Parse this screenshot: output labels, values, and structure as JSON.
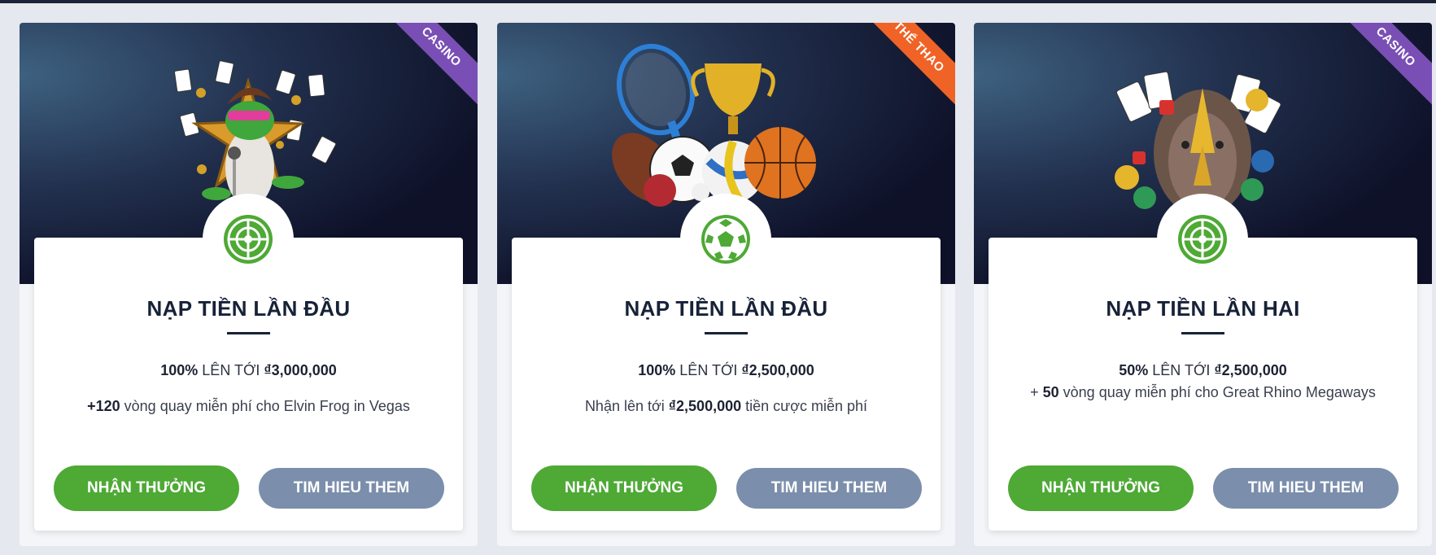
{
  "colors": {
    "accent_green": "#4ea935",
    "secondary_button": "#7b8eab",
    "casino_ribbon": "#7a4fb5",
    "sports_ribbon": "#ef6326",
    "title": "#172238"
  },
  "cards": [
    {
      "ribbon": "CASINO",
      "art": "frog-singer-casino-art",
      "icon": "roulette-icon",
      "title": "NẠP TIỀN LẦN ĐẦU",
      "line1_bold": "100%",
      "line1_mid": " LÊN TỚI ",
      "line1_amount": "₫3,000,000",
      "line2_bold": "+120",
      "line2_text": " vòng quay miễn phí cho Elvin Frog in Vegas",
      "claim_label": "NHẬN THƯỞNG",
      "more_label": "TIM HIEU THEM"
    },
    {
      "ribbon": "THỂ THAO",
      "art": "sports-balls-trophy-art",
      "icon": "soccer-ball-icon",
      "title": "NẠP TIỀN LẦN ĐẦU",
      "line1_bold": "100%",
      "line1_mid": " LÊN TỚI ",
      "line1_amount": "₫2,500,000",
      "line2_pre": "Nhận lên tới ",
      "line2_bold": "₫2,500,000",
      "line2_text": " tiền cược miễn phí",
      "claim_label": "NHẬN THƯỞNG",
      "more_label": "TIM HIEU THEM"
    },
    {
      "ribbon": "CASINO",
      "art": "rhino-casino-art",
      "icon": "roulette-icon",
      "title": "NẠP TIỀN LẦN HAI",
      "line1_bold": "50%",
      "line1_mid": " LÊN TỚI ",
      "line1_amount": "₫2,500,000",
      "line2_pre": "+ ",
      "line2_bold": "50",
      "line2_text": " vòng quay miễn phí cho Great Rhino Megaways",
      "claim_label": "NHẬN THƯỞNG",
      "more_label": "TIM HIEU THEM"
    }
  ]
}
